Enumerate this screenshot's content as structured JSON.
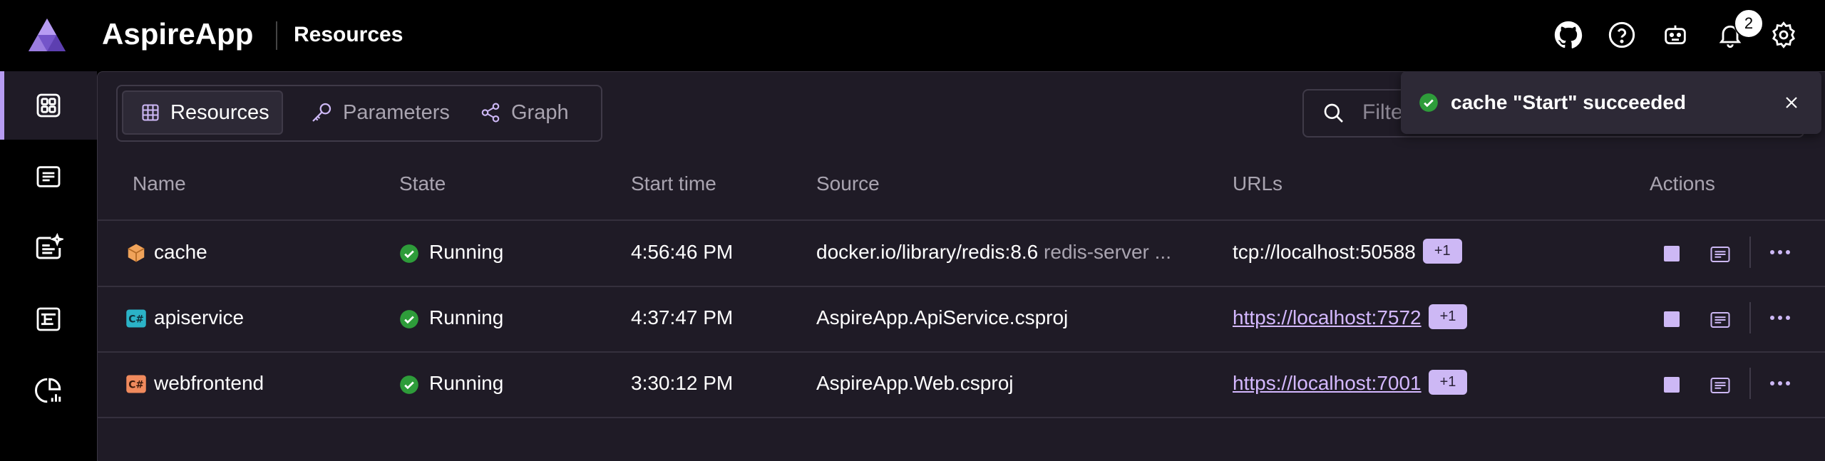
{
  "header": {
    "app_title": "AspireApp",
    "page_title": "Resources",
    "notification_count": "2",
    "icons": [
      "github-icon",
      "help-icon",
      "copilot-icon",
      "bell-icon",
      "gear-icon"
    ]
  },
  "sidebar": {
    "items": [
      {
        "name": "resources",
        "icon": "grid-icon",
        "active": true
      },
      {
        "name": "console-logs",
        "icon": "console-icon",
        "active": false
      },
      {
        "name": "structured-logs",
        "icon": "structured-logs-icon",
        "active": false
      },
      {
        "name": "traces",
        "icon": "traces-icon",
        "active": false
      },
      {
        "name": "metrics",
        "icon": "metrics-icon",
        "active": false
      }
    ]
  },
  "tabs": [
    {
      "label": "Resources",
      "icon": "table-icon",
      "active": true
    },
    {
      "label": "Parameters",
      "icon": "key-icon",
      "active": false
    },
    {
      "label": "Graph",
      "icon": "graph-icon",
      "active": false
    }
  ],
  "filter": {
    "placeholder": "Filter..."
  },
  "toast": {
    "message": "cache \"Start\" succeeded"
  },
  "table": {
    "headers": {
      "name": "Name",
      "state": "State",
      "start_time": "Start time",
      "source": "Source",
      "urls": "URLs",
      "actions": "Actions"
    },
    "rows": [
      {
        "name": "cache",
        "type_icon": "container-icon",
        "state": "Running",
        "start_time": "4:56:46 PM",
        "source": "docker.io/library/redis:8.6",
        "source_args": "redis-server ...",
        "url": "tcp://localhost:50588",
        "url_is_link": false,
        "extra_urls": "+1"
      },
      {
        "name": "apiservice",
        "type_icon": "csharp-project-icon",
        "state": "Running",
        "start_time": "4:37:47 PM",
        "source": "AspireApp.ApiService.csproj",
        "source_args": "",
        "url": "https://localhost:7572",
        "url_is_link": true,
        "extra_urls": "+1"
      },
      {
        "name": "webfrontend",
        "type_icon": "csharp-project-icon",
        "state": "Running",
        "start_time": "3:30:12 PM",
        "source": "AspireApp.Web.csproj",
        "source_args": "",
        "url": "https://localhost:7001",
        "url_is_link": true,
        "extra_urls": "+1"
      }
    ]
  },
  "colors": {
    "accent": "#b79cf2",
    "running": "#2e9c3a",
    "background": "#1f1b26"
  }
}
